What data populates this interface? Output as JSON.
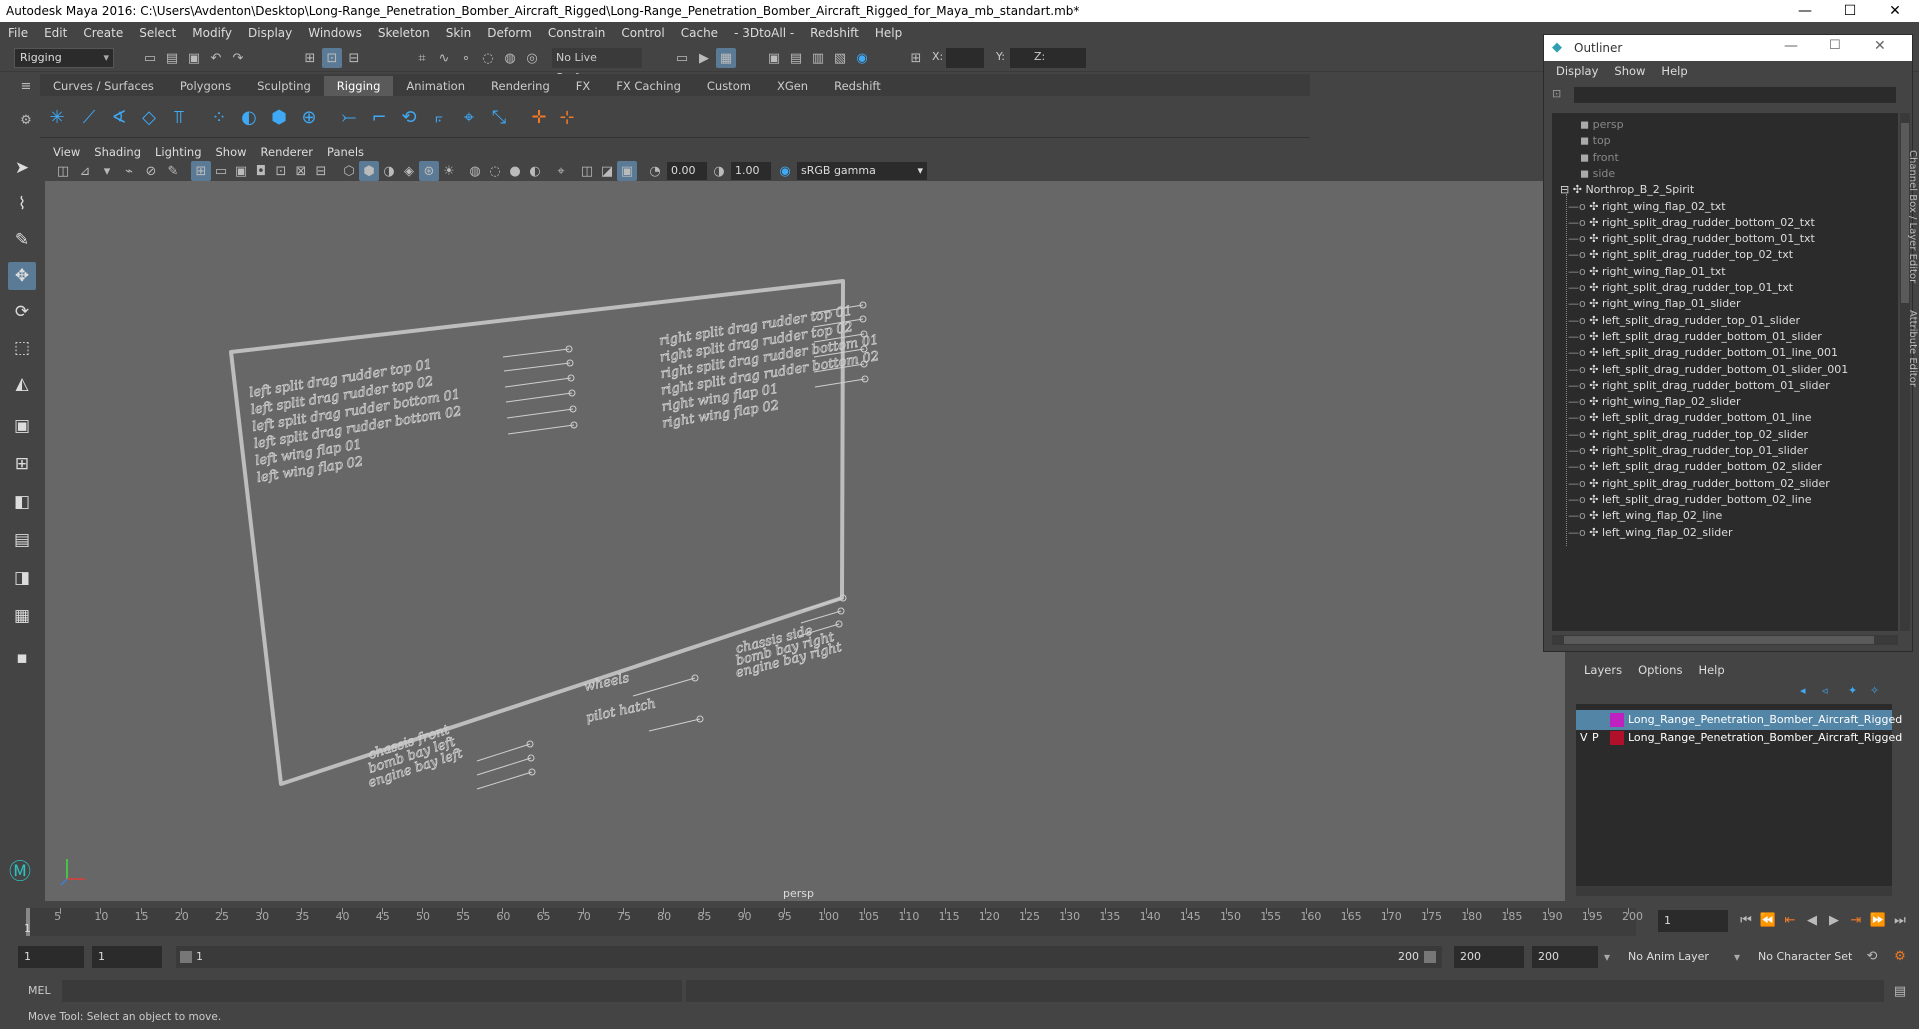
{
  "window": {
    "title": "Autodesk Maya 2016: C:\\Users\\Avdenton\\Desktop\\Long-Range_Penetration_Bomber_Aircraft_Rigged\\Long-Range_Penetration_Bomber_Aircraft_Rigged_for_Maya_mb_standart.mb*",
    "minimize": "—",
    "maximize": "☐",
    "close": "✕"
  },
  "menubar": [
    "File",
    "Edit",
    "Create",
    "Select",
    "Modify",
    "Display",
    "Windows",
    "Skeleton",
    "Skin",
    "Deform",
    "Constrain",
    "Control",
    "Cache",
    "- 3DtoAll -",
    "Redshift",
    "Help"
  ],
  "statusline": {
    "mode": "Rigging",
    "live_surface": "No Live Surface",
    "x_label": "X:",
    "y_label": "Y:",
    "z_label": "Z:"
  },
  "shelf_tabs": [
    {
      "label": "Curves / Surfaces",
      "active": false
    },
    {
      "label": "Polygons",
      "active": false
    },
    {
      "label": "Sculpting",
      "active": false
    },
    {
      "label": "Rigging",
      "active": true
    },
    {
      "label": "Animation",
      "active": false
    },
    {
      "label": "Rendering",
      "active": false
    },
    {
      "label": "FX",
      "active": false
    },
    {
      "label": "FX Caching",
      "active": false
    },
    {
      "label": "Custom",
      "active": false
    },
    {
      "label": "XGen",
      "active": false
    },
    {
      "label": "Redshift",
      "active": false
    }
  ],
  "panel_menu": [
    "View",
    "Shading",
    "Lighting",
    "Show",
    "Renderer",
    "Panels"
  ],
  "panel_toolbar": {
    "exposure": "0.00",
    "gamma": "1.00",
    "colorspace": "sRGB gamma"
  },
  "viewport": {
    "camera": "persp",
    "board_left": [
      "left split drag rudder top 01",
      "left split drag rudder top 02",
      "left split drag rudder bottom 01",
      "left split drag rudder bottom 02",
      "left wing flap 01",
      "left wing flap 02"
    ],
    "board_right": [
      "right split drag rudder top 01",
      "right split drag rudder top 02",
      "right split drag rudder bottom 01",
      "right split drag rudder bottom 02",
      "right wing flap 01",
      "right wing flap 02"
    ],
    "board_mid": [
      "wheels",
      "pilot hatch"
    ],
    "board_bottom_left": [
      "chassis front",
      "bomb bay left",
      "engine bay left"
    ],
    "board_bottom_right": [
      "chassis side",
      "bomb bay right",
      "engine bay right"
    ]
  },
  "outliner": {
    "title": "Outliner",
    "menu": [
      "Display",
      "Show",
      "Help"
    ],
    "cameras": [
      "persp",
      "top",
      "front",
      "side"
    ],
    "root": "Northrop_B_2_Spirit",
    "children": [
      "right_wing_flap_02_txt",
      "right_split_drag_rudder_bottom_02_txt",
      "right_split_drag_rudder_bottom_01_txt",
      "right_split_drag_rudder_top_02_txt",
      "right_wing_flap_01_txt",
      "right_split_drag_rudder_top_01_txt",
      "right_wing_flap_01_slider",
      "left_split_drag_rudder_top_01_slider",
      "left_split_drag_rudder_bottom_01_slider",
      "left_split_drag_rudder_bottom_01_line_001",
      "left_split_drag_rudder_bottom_01_slider_001",
      "right_split_drag_rudder_bottom_01_slider",
      "right_wing_flap_02_slider",
      "left_split_drag_rudder_bottom_01_line",
      "right_split_drag_rudder_top_02_slider",
      "right_split_drag_rudder_top_01_slider",
      "left_split_drag_rudder_bottom_02_slider",
      "right_split_drag_rudder_bottom_02_slider",
      "left_split_drag_rudder_bottom_02_line",
      "left_wing_flap_02_line",
      "left_wing_flap_02_slider"
    ]
  },
  "layers": {
    "menu": [
      "Layers",
      "Options",
      "Help"
    ],
    "rows": [
      {
        "v": "",
        "p": "",
        "name": "Long_Range_Penetration_Bomber_Aircraft_Rigged",
        "color": "#c020c0",
        "selected": true
      },
      {
        "v": "V",
        "p": "P",
        "name": "Long_Range_Penetration_Bomber_Aircraft_Rigged",
        "color": "#b0102a",
        "selected": false
      }
    ]
  },
  "side_tabs": [
    "Channel Box / Layer Editor",
    "Attribute Editor"
  ],
  "timeline": {
    "ticks": [
      "5",
      "10",
      "15",
      "20",
      "25",
      "30",
      "35",
      "40",
      "45",
      "50",
      "55",
      "60",
      "65",
      "70",
      "75",
      "80",
      "85",
      "90",
      "95",
      "100",
      "105",
      "110",
      "115",
      "120",
      "125",
      "130",
      "135",
      "140",
      "145",
      "150",
      "155",
      "160",
      "165",
      "170",
      "175",
      "180",
      "185",
      "190",
      "195",
      "200"
    ],
    "current_frame": "1",
    "current_marker": "1"
  },
  "range": {
    "start": "1",
    "playback_start": "1",
    "slider_start": "1",
    "slider_end": "200",
    "playback_end": "200",
    "end": "200",
    "anim_layer": "No Anim Layer",
    "character_set": "No Character Set"
  },
  "cmdline": {
    "label": "MEL"
  },
  "help": "Move Tool: Select an object to move."
}
